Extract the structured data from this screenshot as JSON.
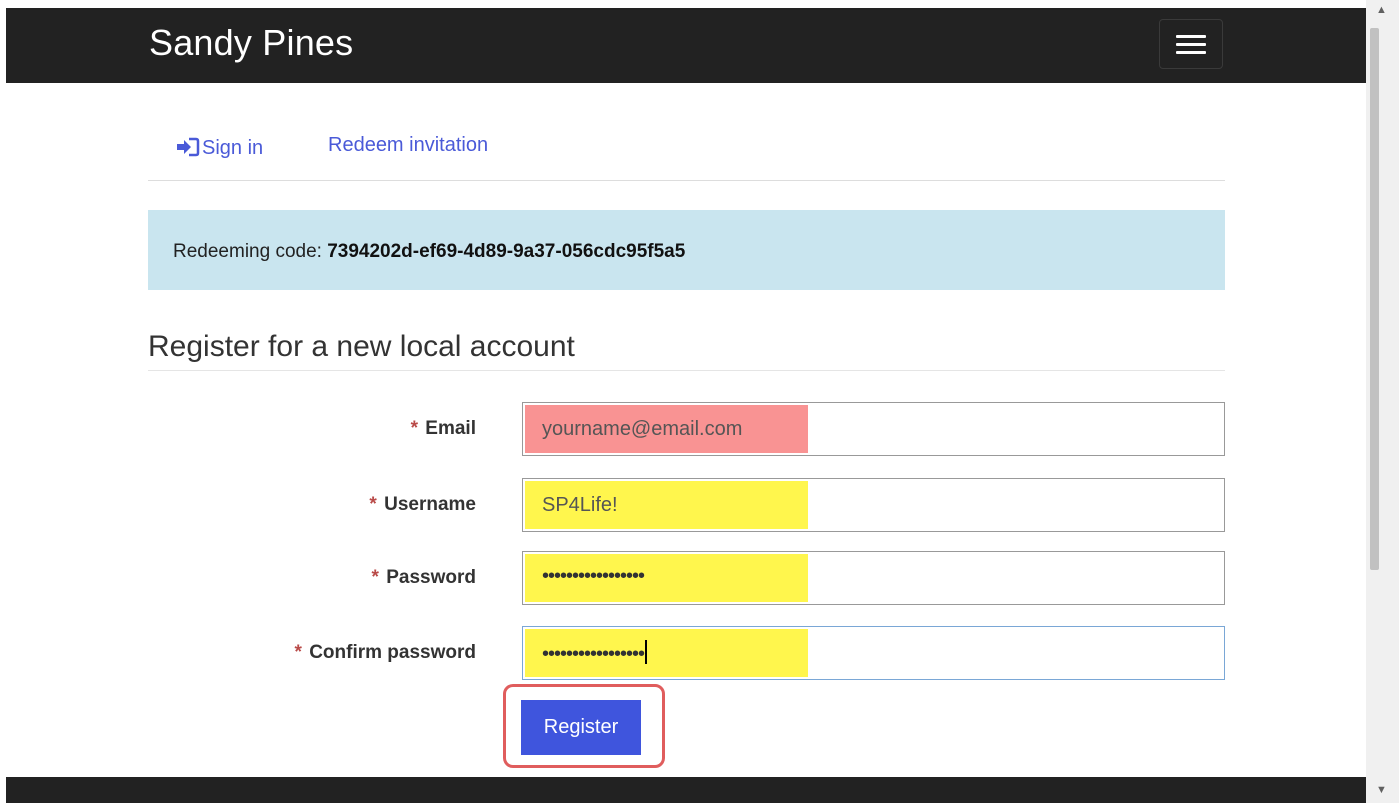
{
  "navbar": {
    "brand": "Sandy Pines",
    "menu_icon": "hamburger-menu-icon",
    "background": "#222222"
  },
  "tabs": [
    {
      "label": "Sign in",
      "icon": "sign-in-icon"
    },
    {
      "label": "Redeem invitation"
    }
  ],
  "alert": {
    "prefix": "Redeeming code: ",
    "code": "7394202d-ef69-4d89-9a37-056cdc95f5a5",
    "background": "#c9e5ef"
  },
  "heading": "Register for a new local account",
  "form": {
    "required_marker": "*",
    "email": {
      "label": "Email",
      "value": "yourname@email.com",
      "highlight": "#f99393"
    },
    "username": {
      "label": "Username",
      "value": "SP4Life!",
      "highlight": "#fff64d"
    },
    "password": {
      "label": "Password",
      "value": "•••••••••••••••••",
      "highlight": "#fff64d"
    },
    "confirm_password": {
      "label": "Confirm password",
      "value": "•••••••••••••••••",
      "highlight": "#fff64d"
    },
    "submit_label": "Register",
    "submit_color": "#3f55dd"
  }
}
